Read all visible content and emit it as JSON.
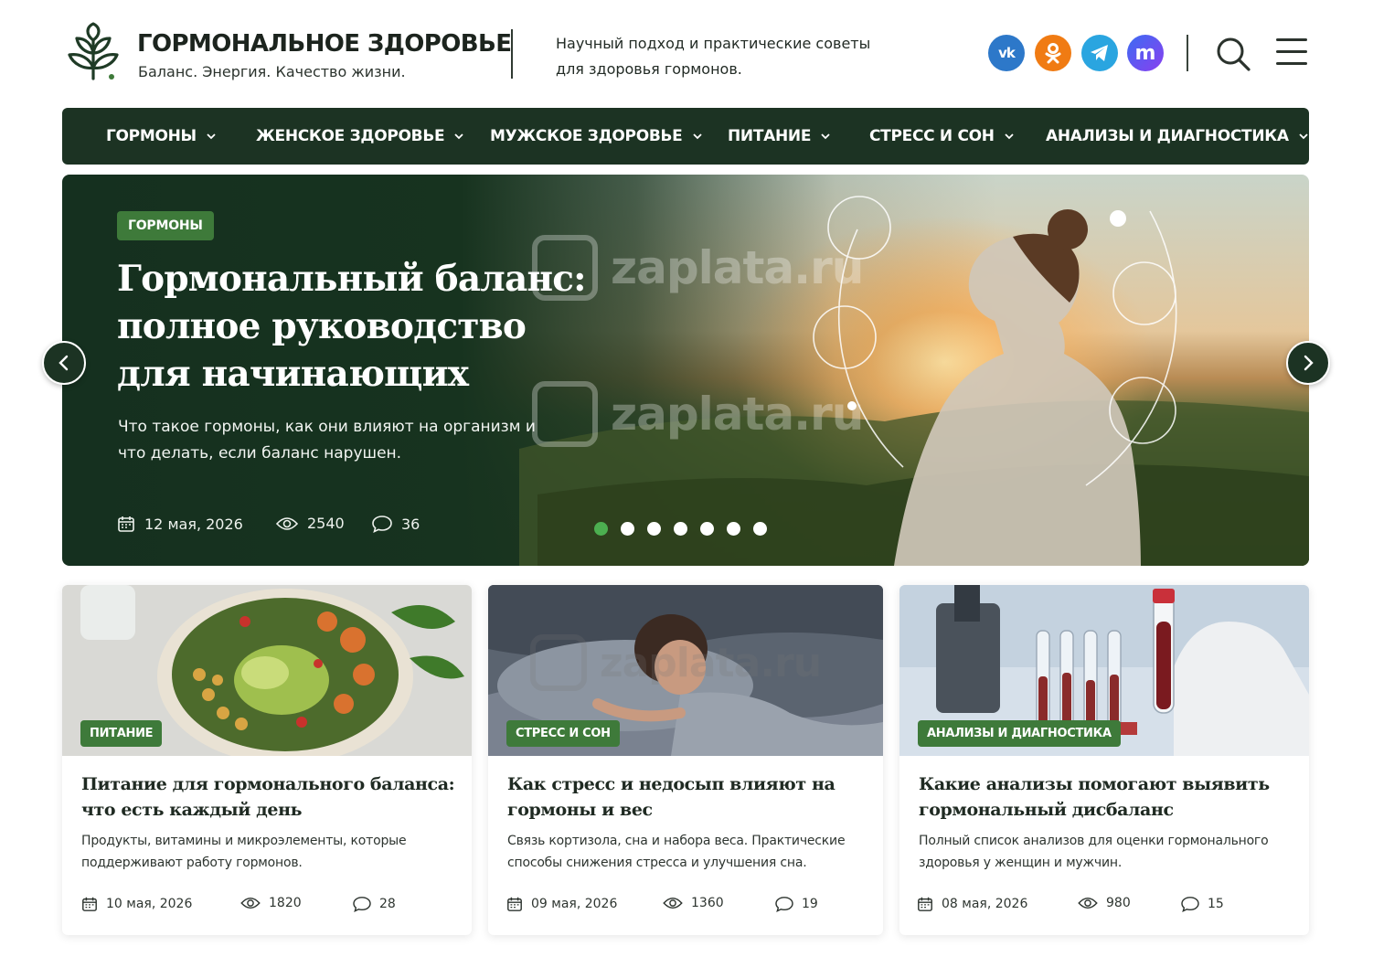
{
  "header": {
    "site_title": "ГОРМОНАЛЬНОЕ ЗДОРОВЬЕ",
    "tagline": "Баланс. Энергия. Качество жизни.",
    "description": "Научный подход и практические советы для здоровья гормонов.",
    "social": [
      {
        "name": "vk",
        "icon": "vk-icon",
        "glyph": "vk",
        "color": "#2d78c9"
      },
      {
        "name": "ok",
        "icon": "odnoklassniki-icon",
        "color": "#f07b13"
      },
      {
        "name": "telegram",
        "icon": "telegram-icon",
        "color": "#2aa5e0"
      },
      {
        "name": "max",
        "icon": "max-messenger-icon",
        "glyph": "m",
        "color": "#5a55f1"
      }
    ]
  },
  "nav": {
    "items": [
      {
        "label": "ГОРМОНЫ"
      },
      {
        "label": "ЖЕНСКОЕ ЗДОРОВЬЕ"
      },
      {
        "label": "МУЖСКОЕ ЗДОРОВЬЕ"
      },
      {
        "label": "ПИТАНИЕ"
      },
      {
        "label": "СТРЕСС И СОН"
      },
      {
        "label": "АНАЛИЗЫ И ДИАГНОСТИКА"
      }
    ]
  },
  "hero": {
    "tag": "ГОРМОНЫ",
    "title": "Гормональный баланс: полное руководство для начинающих",
    "subtitle": "Что такое гормоны, как они влияют на организм и что делать, если баланс нарушен.",
    "date": "12 мая, 2026",
    "views": "2540",
    "comments": "36",
    "slide_count": 7,
    "active_slide": 1
  },
  "cards": [
    {
      "tag": "ПИТАНИЕ",
      "title": "Питание для гормонального баланса: что есть каждый день",
      "description": "Продукты, витамины и микроэлементы, которые поддерживают работу гормонов.",
      "date": "10 мая, 2026",
      "views": "1820",
      "comments": "28"
    },
    {
      "tag": "СТРЕСС И СОН",
      "title": "Как стресс и недосып влияют на гормоны и вес",
      "description": "Связь кортизола, сна и набора веса. Практические способы снижения стресса и улучшения сна.",
      "date": "09 мая, 2026",
      "views": "1360",
      "comments": "19"
    },
    {
      "tag": "АНАЛИЗЫ И ДИАГНОСТИКА",
      "title": "Какие анализы помогают выявить гормональный дисбаланс",
      "description": "Полный список анализов для оценки гормонального здоровья у женщин и мужчин.",
      "date": "08 мая, 2026",
      "views": "980",
      "comments": "15"
    }
  ],
  "watermark": "zaplata.ru",
  "colors": {
    "brand_dark": "#1c3323",
    "tag_green": "#3e7a3a",
    "active_dot": "#4caf50"
  }
}
